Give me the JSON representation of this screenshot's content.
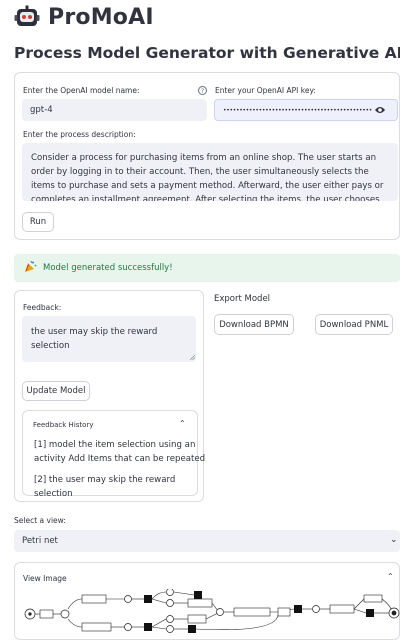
{
  "app": {
    "title": "ProMoAI",
    "subtitle": "Process Model Generator with Generative AI"
  },
  "settings": {
    "model_label": "Enter the OpenAI model name:",
    "model_value": "gpt-4",
    "api_label": "Enter your OpenAI API key:",
    "api_value": "••••••••••••••••••••••••••••••••••••••••••••••",
    "description_label": "Enter the process description:",
    "description_value": "Consider a process for purchasing items from an online shop. The user starts an order by logging in to their account. Then, the user simultaneously selects the items to purchase and sets a payment method. Afterward, the user either pays or completes an installment agreement. After selecting the items, the user chooses between multiple options for a free",
    "run_label": "Run"
  },
  "status": {
    "message": "Model generated successfully!"
  },
  "feedback": {
    "label": "Feedback:",
    "value": "the user may skip the reward selection",
    "update_label": "Update Model",
    "history_title": "Feedback History",
    "history": [
      "[1] model the item selection using an activity Add Items that can be repeated",
      "[2] the user may skip the reward selection"
    ]
  },
  "export": {
    "title": "Export Model",
    "bpmn_label": "Download BPMN",
    "pnml_label": "Download PNML"
  },
  "view": {
    "select_label": "Select a view:",
    "selected": "Petri net",
    "image_title": "View Image"
  },
  "colors": {
    "success_bg": "#e8f5ec",
    "success_text": "#1f7a43",
    "field_bg": "#eff1f6",
    "text": "#31333f"
  }
}
